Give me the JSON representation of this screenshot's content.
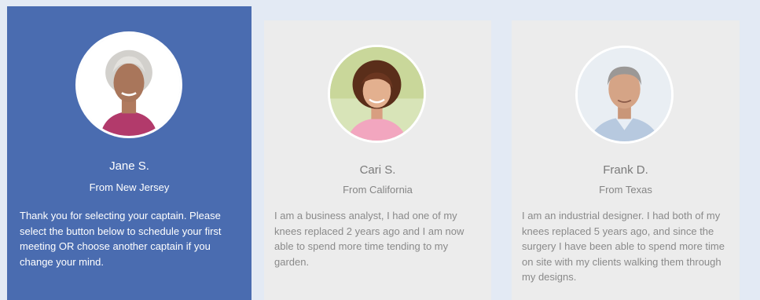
{
  "captains": [
    {
      "name": "Jane S.",
      "location": "From New Jersey",
      "bio": "Thank you for selecting your captain. Please select the button below to schedule your first meeting OR choose another captain if you change your mind.",
      "selected": true
    },
    {
      "name": "Cari S.",
      "location": "From California",
      "bio": "I am a business analyst, I had one of my knees replaced 2 years ago and I am now able to spend more time tending to my garden.",
      "selected": false
    },
    {
      "name": "Frank D.",
      "location": "From Texas",
      "bio": "I am an industrial designer. I had both of my knees replaced 5 years ago, and since the surgery I have been able to spend more time on site with my clients walking them through my designs.",
      "selected": false
    }
  ],
  "colors": {
    "selected_bg": "#4a6cb0",
    "card_bg": "#ececec",
    "page_bg": "#e3eaf4"
  }
}
